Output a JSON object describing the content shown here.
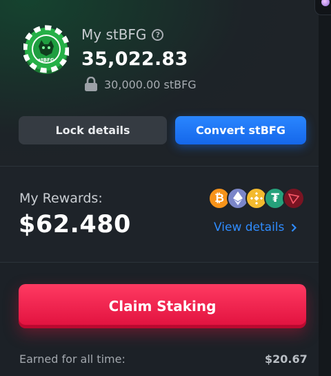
{
  "staking": {
    "title": "My stBFG",
    "help_icon": "question-circle-icon",
    "balance": "35,022.83",
    "locked_amount": "30,000.00 stBFG",
    "token_logo_text": "stBFG"
  },
  "actions": {
    "lock_details_label": "Lock details",
    "convert_label": "Convert stBFG"
  },
  "rewards": {
    "label": "My Rewards:",
    "amount": "$62.480",
    "view_details_label": "View details",
    "coins": [
      "bitcoin-icon",
      "ethereum-icon",
      "bnb-icon",
      "tether-icon",
      "tron-icon"
    ]
  },
  "claim": {
    "button_label": "Claim Staking",
    "earned_label": "Earned for all time:",
    "earned_value": "$20.67"
  },
  "colors": {
    "accent_blue": "#1e78ff",
    "claim_red": "#f0184a",
    "background": "#1b2026"
  }
}
